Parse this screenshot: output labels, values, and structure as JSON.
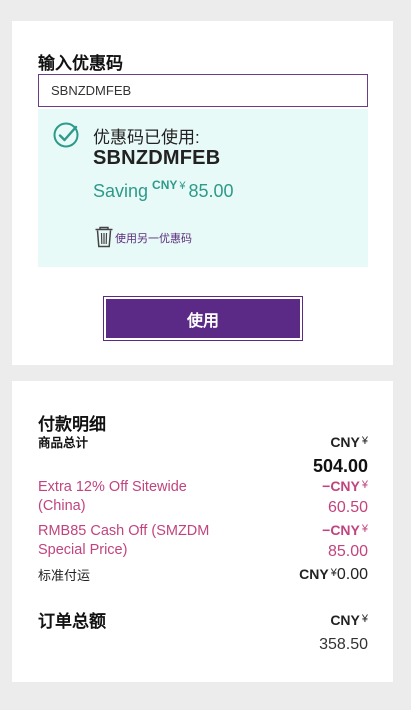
{
  "promo": {
    "title": "输入优惠码",
    "input_value": "SBNZDMFEB",
    "applied_label": "优惠码已使用:",
    "applied_code": "SBNZDMFEB",
    "saving_word": "Saving",
    "saving_currency": "CNY",
    "saving_symbol": "¥",
    "saving_amount": "85.00",
    "remove_text": "使用另一优惠码",
    "apply_button": "使用"
  },
  "payment": {
    "title": "付款明细",
    "subtotal_label": "商品总计",
    "subtotal_currency": "CNY",
    "subtotal_symbol": "¥",
    "subtotal_amount": "504.00",
    "discounts": [
      {
        "label": "Extra 12% Off Sitewide (China)",
        "prefix": "−CNY",
        "symbol": "¥",
        "amount": "60.50"
      },
      {
        "label": "RMB85 Cash Off (SMZDM Special Price)",
        "prefix": "−CNY",
        "symbol": "¥",
        "amount": "85.00"
      }
    ],
    "shipping_label": "标准付运",
    "shipping_currency": "CNY",
    "shipping_symbol": "¥",
    "shipping_amount": "0.00",
    "total_label": "订单总额",
    "total_currency": "CNY",
    "total_symbol": "¥",
    "total_amount": "358.50"
  },
  "colors": {
    "brand_purple": "#5b2a86",
    "success_teal": "#2e9a8a",
    "applied_bg": "#e8faf8",
    "discount_pink": "#c0447f"
  },
  "icons": {
    "applied": "check-circle-icon",
    "remove": "trash-icon"
  }
}
